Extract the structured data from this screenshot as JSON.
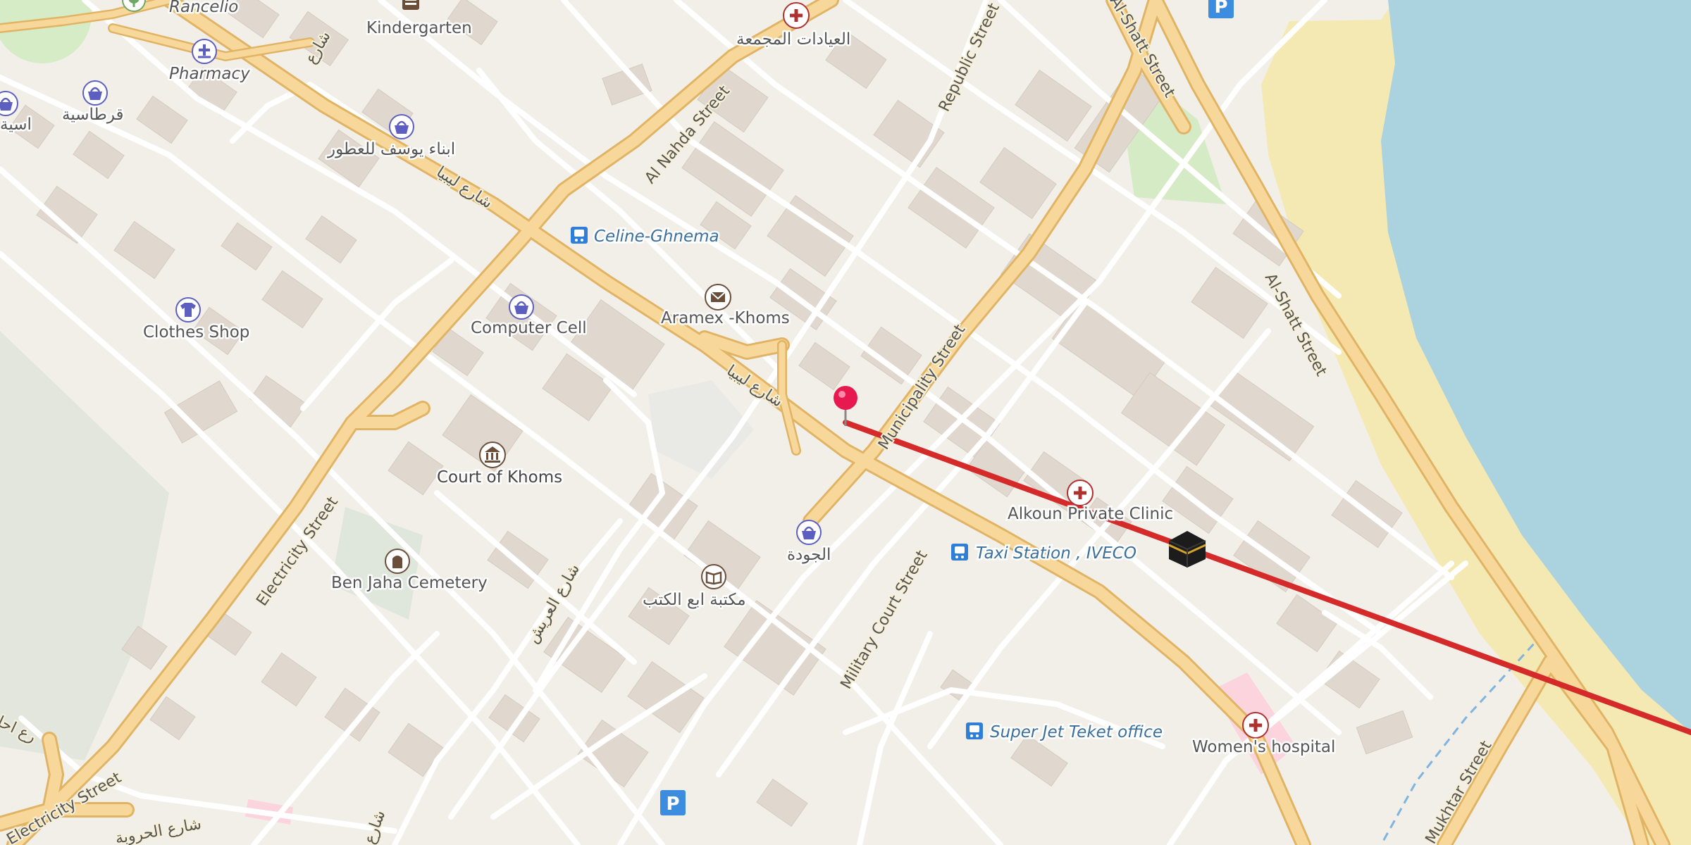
{
  "map": {
    "colors": {
      "land": "#f2efe9",
      "water": "#aad3df",
      "beach": "#f5e9b3",
      "road_major_fill": "#f7d89a",
      "road_major_casing": "#e0b464",
      "road_minor": "#ffffff",
      "building": "#e3dbd1",
      "park": "#cfe8c4",
      "hospital_area": "#fbd1dc",
      "route_line": "#d42a2a",
      "marker_pin": "#e8194f",
      "medical_icon": "#b03030",
      "shop_icon": "#5c5fbf",
      "transit_icon": "#2f7fd8",
      "parking_icon": "#3c8ddf"
    },
    "pois": [
      {
        "key": "rancelio",
        "label": "Rancelio",
        "icon": "tree-icon"
      },
      {
        "key": "kindergarten",
        "label": "Kindergarten",
        "icon": "school-icon"
      },
      {
        "key": "pharmacy",
        "label": "Pharmacy",
        "icon": "pharmacy-icon"
      },
      {
        "key": "qurtasiya",
        "label": "قرطاسية",
        "icon": "shop-basket-icon"
      },
      {
        "key": "qurtasiya_partial",
        "label": "اسية",
        "icon": "shop-basket-icon"
      },
      {
        "key": "perfume",
        "label": "ابناء يوسف للعطور",
        "icon": "shop-basket-icon"
      },
      {
        "key": "clinic_group",
        "label": "العيادات المجمعة",
        "icon": "medical-cross-icon"
      },
      {
        "key": "celine",
        "label": "Celine-Ghnema",
        "icon": "bus-icon"
      },
      {
        "key": "clothes",
        "label": "Clothes Shop",
        "icon": "clothes-icon"
      },
      {
        "key": "computer",
        "label": "Computer Cell",
        "icon": "shop-basket-icon"
      },
      {
        "key": "aramex",
        "label": "Aramex -Khoms",
        "icon": "envelope-icon"
      },
      {
        "key": "court",
        "label": "Court of Khoms",
        "icon": "courthouse-icon"
      },
      {
        "key": "cemetery",
        "label": "Ben Jaha Cemetery",
        "icon": "cemetery-icon"
      },
      {
        "key": "aljawda",
        "label": "الجودة",
        "icon": "shop-basket-icon"
      },
      {
        "key": "library",
        "label": "مكتبة ابع الكتب",
        "icon": "book-icon"
      },
      {
        "key": "alkoun",
        "label": "Alkoun Private Clinic",
        "icon": "medical-cross-icon"
      },
      {
        "key": "taxi",
        "label": "Taxi Station , IVECO",
        "icon": "bus-icon"
      },
      {
        "key": "superjet",
        "label": "Super Jet Teket office",
        "icon": "bus-icon"
      },
      {
        "key": "womens",
        "label": "Women's hospital",
        "icon": "medical-cross-icon"
      },
      {
        "key": "parking_top",
        "label": "P",
        "icon": "parking-icon"
      },
      {
        "key": "parking_bottom",
        "label": "P",
        "icon": "parking-icon"
      }
    ],
    "streets": {
      "al_nahda": "Al Nahda Street",
      "republic": "Republic Street",
      "al_shatt_top": "Al-Shatt Street",
      "al_shatt": "Al-Shatt Street",
      "municipality": "Municipality Street",
      "military_court": "Military Court Street",
      "electricity_mid": "Electricity Street",
      "electricity_bottom": "Electricity Street",
      "mukhtar": "Mukhtar Street",
      "libya_1": "شارع ليبيا",
      "libya_2": "شارع ليبيا",
      "arabic_diag": "شارع العريش",
      "arabic_top": "شارع",
      "arabic_bottom_left": "شارع الحروبة",
      "arabic_bottom_mid": "شارع",
      "arabic_left_edge": "رع احا"
    },
    "markers": {
      "start_pin": "map-pin-icon",
      "destination": "kaaba-icon"
    }
  }
}
